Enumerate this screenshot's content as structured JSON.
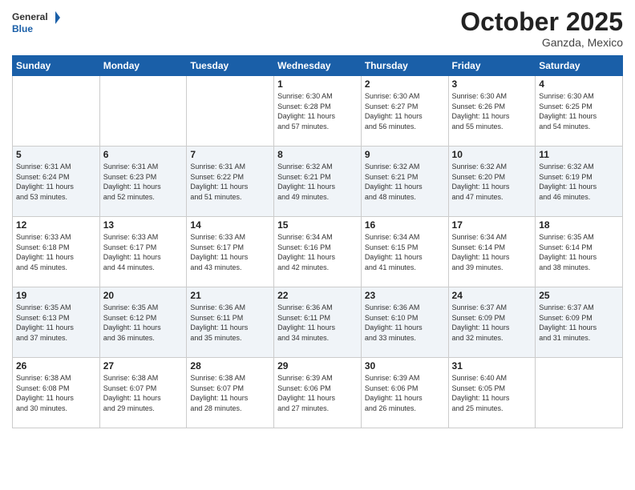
{
  "header": {
    "logo_line1": "General",
    "logo_line2": "Blue",
    "month": "October 2025",
    "location": "Ganzda, Mexico"
  },
  "days_of_week": [
    "Sunday",
    "Monday",
    "Tuesday",
    "Wednesday",
    "Thursday",
    "Friday",
    "Saturday"
  ],
  "weeks": [
    [
      {
        "day": "",
        "info": ""
      },
      {
        "day": "",
        "info": ""
      },
      {
        "day": "",
        "info": ""
      },
      {
        "day": "1",
        "info": "Sunrise: 6:30 AM\nSunset: 6:28 PM\nDaylight: 11 hours\nand 57 minutes."
      },
      {
        "day": "2",
        "info": "Sunrise: 6:30 AM\nSunset: 6:27 PM\nDaylight: 11 hours\nand 56 minutes."
      },
      {
        "day": "3",
        "info": "Sunrise: 6:30 AM\nSunset: 6:26 PM\nDaylight: 11 hours\nand 55 minutes."
      },
      {
        "day": "4",
        "info": "Sunrise: 6:30 AM\nSunset: 6:25 PM\nDaylight: 11 hours\nand 54 minutes."
      }
    ],
    [
      {
        "day": "5",
        "info": "Sunrise: 6:31 AM\nSunset: 6:24 PM\nDaylight: 11 hours\nand 53 minutes."
      },
      {
        "day": "6",
        "info": "Sunrise: 6:31 AM\nSunset: 6:23 PM\nDaylight: 11 hours\nand 52 minutes."
      },
      {
        "day": "7",
        "info": "Sunrise: 6:31 AM\nSunset: 6:22 PM\nDaylight: 11 hours\nand 51 minutes."
      },
      {
        "day": "8",
        "info": "Sunrise: 6:32 AM\nSunset: 6:21 PM\nDaylight: 11 hours\nand 49 minutes."
      },
      {
        "day": "9",
        "info": "Sunrise: 6:32 AM\nSunset: 6:21 PM\nDaylight: 11 hours\nand 48 minutes."
      },
      {
        "day": "10",
        "info": "Sunrise: 6:32 AM\nSunset: 6:20 PM\nDaylight: 11 hours\nand 47 minutes."
      },
      {
        "day": "11",
        "info": "Sunrise: 6:32 AM\nSunset: 6:19 PM\nDaylight: 11 hours\nand 46 minutes."
      }
    ],
    [
      {
        "day": "12",
        "info": "Sunrise: 6:33 AM\nSunset: 6:18 PM\nDaylight: 11 hours\nand 45 minutes."
      },
      {
        "day": "13",
        "info": "Sunrise: 6:33 AM\nSunset: 6:17 PM\nDaylight: 11 hours\nand 44 minutes."
      },
      {
        "day": "14",
        "info": "Sunrise: 6:33 AM\nSunset: 6:17 PM\nDaylight: 11 hours\nand 43 minutes."
      },
      {
        "day": "15",
        "info": "Sunrise: 6:34 AM\nSunset: 6:16 PM\nDaylight: 11 hours\nand 42 minutes."
      },
      {
        "day": "16",
        "info": "Sunrise: 6:34 AM\nSunset: 6:15 PM\nDaylight: 11 hours\nand 41 minutes."
      },
      {
        "day": "17",
        "info": "Sunrise: 6:34 AM\nSunset: 6:14 PM\nDaylight: 11 hours\nand 39 minutes."
      },
      {
        "day": "18",
        "info": "Sunrise: 6:35 AM\nSunset: 6:14 PM\nDaylight: 11 hours\nand 38 minutes."
      }
    ],
    [
      {
        "day": "19",
        "info": "Sunrise: 6:35 AM\nSunset: 6:13 PM\nDaylight: 11 hours\nand 37 minutes."
      },
      {
        "day": "20",
        "info": "Sunrise: 6:35 AM\nSunset: 6:12 PM\nDaylight: 11 hours\nand 36 minutes."
      },
      {
        "day": "21",
        "info": "Sunrise: 6:36 AM\nSunset: 6:11 PM\nDaylight: 11 hours\nand 35 minutes."
      },
      {
        "day": "22",
        "info": "Sunrise: 6:36 AM\nSunset: 6:11 PM\nDaylight: 11 hours\nand 34 minutes."
      },
      {
        "day": "23",
        "info": "Sunrise: 6:36 AM\nSunset: 6:10 PM\nDaylight: 11 hours\nand 33 minutes."
      },
      {
        "day": "24",
        "info": "Sunrise: 6:37 AM\nSunset: 6:09 PM\nDaylight: 11 hours\nand 32 minutes."
      },
      {
        "day": "25",
        "info": "Sunrise: 6:37 AM\nSunset: 6:09 PM\nDaylight: 11 hours\nand 31 minutes."
      }
    ],
    [
      {
        "day": "26",
        "info": "Sunrise: 6:38 AM\nSunset: 6:08 PM\nDaylight: 11 hours\nand 30 minutes."
      },
      {
        "day": "27",
        "info": "Sunrise: 6:38 AM\nSunset: 6:07 PM\nDaylight: 11 hours\nand 29 minutes."
      },
      {
        "day": "28",
        "info": "Sunrise: 6:38 AM\nSunset: 6:07 PM\nDaylight: 11 hours\nand 28 minutes."
      },
      {
        "day": "29",
        "info": "Sunrise: 6:39 AM\nSunset: 6:06 PM\nDaylight: 11 hours\nand 27 minutes."
      },
      {
        "day": "30",
        "info": "Sunrise: 6:39 AM\nSunset: 6:06 PM\nDaylight: 11 hours\nand 26 minutes."
      },
      {
        "day": "31",
        "info": "Sunrise: 6:40 AM\nSunset: 6:05 PM\nDaylight: 11 hours\nand 25 minutes."
      },
      {
        "day": "",
        "info": ""
      }
    ]
  ]
}
